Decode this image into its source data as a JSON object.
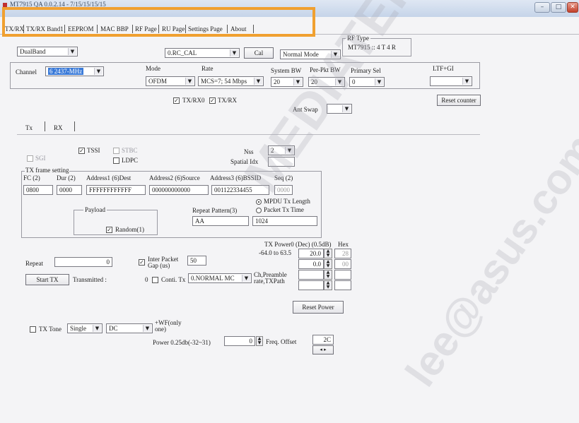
{
  "window": {
    "title": "MT7915 QA 0.0.2.14 - 7/15/15/15/15",
    "controls": [
      "–",
      "□",
      "✕"
    ]
  },
  "tabs": [
    "TX/RX",
    "TX/RX Band1",
    "EEPROM",
    "MAC BBP",
    "RF Page",
    "RU Page",
    "Settings Page",
    "About"
  ],
  "top": {
    "band_select": "DualBand",
    "cal_select": "0.RC_CAL",
    "cal_button": "Cal",
    "mode_select": "Normal Mode",
    "rf_type_label": "RF Type",
    "rf_type_value": "MT7915 :: 4 T 4 R"
  },
  "channel_group": {
    "channel_label": "Channel",
    "channel_value": "6 2437-MHz",
    "mode_label": "Mode",
    "mode_value": "OFDM",
    "rate_label": "Rate",
    "rate_value": "MCS=7; 54 Mbps",
    "system_bw_label": "System BW",
    "system_bw_value": "20",
    "per_pkt_bw_label": "Per-Pkt BW",
    "per_pkt_bw_value": "20",
    "primary_sel_label": "Primary Sel",
    "primary_sel_value": "0",
    "ltf_gi_label": "LTF+GI",
    "ltf_gi_value": ""
  },
  "txrx_checks": {
    "txrx0_label": "TX/RX0",
    "txrx_label": "TX/RX",
    "reset_counter": "Reset counter",
    "ant_swap_label": "Ant Swap",
    "ant_swap_value": ""
  },
  "sub_tabs": [
    "Tx",
    "RX"
  ],
  "tx": {
    "sgi_label": "SGI",
    "tssi_label": "TSSI",
    "stbc_label": "STBC",
    "ldpc_label": "LDPC",
    "nss_label": "Nss",
    "nss_value": "2",
    "spatial_idx_label": "Spatial Idx",
    "spatial_idx_value": "",
    "frame_setting_label": "TX frame setting",
    "fc_label": "FC (2)",
    "dur_label": "Dur (2)",
    "addr1_label": "Address1 (6)Dest",
    "addr2_label": "Address2 (6)Source",
    "addr3_label": "Address3 (6)BSSID",
    "seq_label": "Seq (2)",
    "fc_value": "0800",
    "dur_value": "0000",
    "addr1_value": "FFFFFFFFFFFF",
    "addr2_value": "000000000000",
    "addr3_value": "001122334455",
    "seq_value": "0000",
    "payload_label": "Payload",
    "random_label": "Random(1)",
    "repeat_pattern_label": "Repeat Pattern(3)",
    "repeat_pattern_value": "AA",
    "mpdu_len_label": "MPDU Tx Length",
    "pkt_time_label": "Packet Tx Time",
    "length_value": "1024",
    "repeat_label": "Repeat",
    "repeat_value": "0",
    "inter_packet_label": "Inter Packet Gap (us)",
    "inter_packet_value": "50",
    "start_tx": "Start TX",
    "transmitted_label": "Transmitted :",
    "transmitted_value": "0",
    "conti_label": "Conti. Tx",
    "conti_value": "0.NORMAL MC",
    "ch_preamble_label": "Ch,Preamble rate,TXPath",
    "txpower_header": "TX Power0 (Dec) (0.5dB)",
    "hex_header": "Hex",
    "power_range": "-64.0 to 63.5",
    "power0_dec": "20.0",
    "power0_hex": "28",
    "power1_dec": "0.0",
    "power1_hex": "00",
    "reset_power": "Reset Power",
    "tx_tone_label": "TX Tone",
    "tone_select1": "Single",
    "tone_select2": "DC",
    "wf_only_label": "+WF(only one)",
    "power_025_label": "Power 0.25db(-32~31)",
    "power_025_value": "0",
    "freq_offset_label": "Freq. Offset",
    "freq_offset_value": "2C"
  },
  "watermark": [
    "MEDIATEK CONFIDENTIAL",
    "lee@asus.com"
  ]
}
